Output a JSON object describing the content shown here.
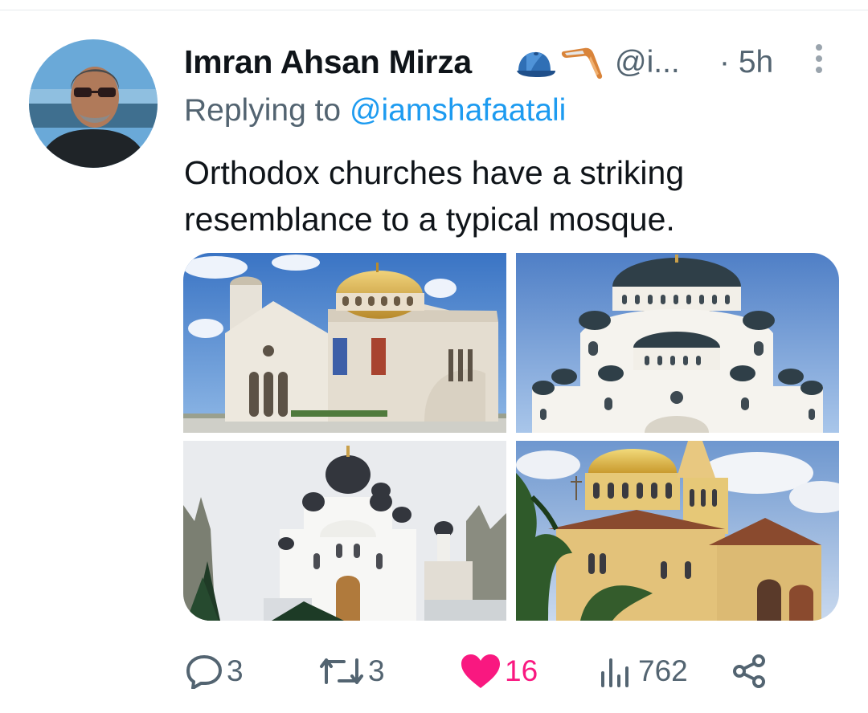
{
  "tweet": {
    "author_name": "Imran Ahsan Mirza",
    "handle": "@i...",
    "time": "· 5h",
    "reply_prefix": "Replying to ",
    "reply_to": "@iamshafaatali",
    "text": "Orthodox churches have a striking resemblance to a typical mosque.",
    "badges": [
      "cap-emoji-icon",
      "boomerang-emoji-icon"
    ]
  },
  "media": {
    "images": [
      {
        "subject": "church-with-gold-dome"
      },
      {
        "subject": "white-cathedral-with-dark-domes"
      },
      {
        "subject": "white-church-with-onion-domes"
      },
      {
        "subject": "yellow-brick-church-with-gold-dome"
      }
    ]
  },
  "actions": {
    "replies": "3",
    "retweets": "3",
    "likes": "16",
    "views": "762"
  },
  "colors": {
    "accent": "#1d9bf0",
    "like": "#f91880",
    "muted": "#536471",
    "text": "#0f1419"
  }
}
